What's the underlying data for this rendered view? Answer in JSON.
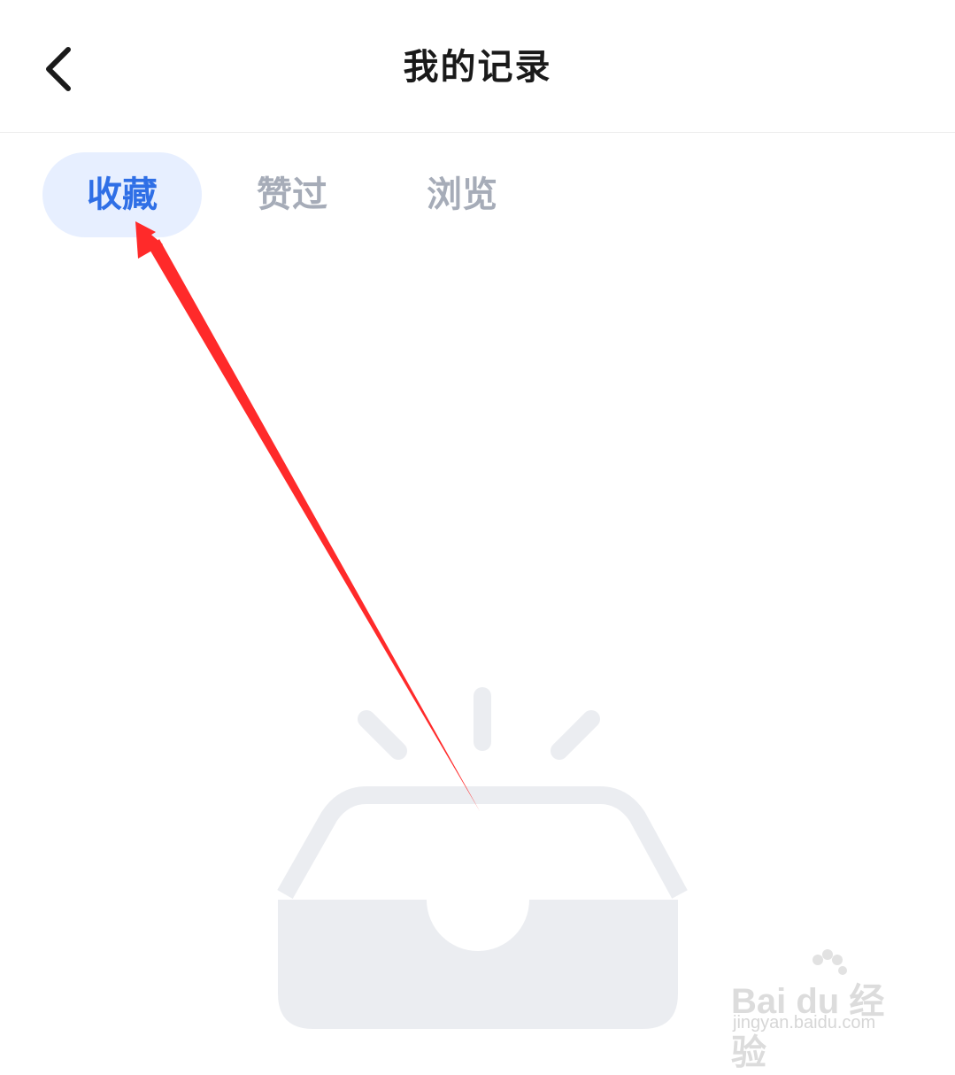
{
  "header": {
    "title": "我的记录",
    "back_icon": "chevron-left-icon"
  },
  "tabs": [
    {
      "label": "收藏",
      "active": true
    },
    {
      "label": "赞过",
      "active": false
    },
    {
      "label": "浏览",
      "active": false
    }
  ],
  "empty_state": {
    "icon": "empty-inbox-icon"
  },
  "annotation": {
    "icon": "red-arrow-icon",
    "color": "#ff2a2a"
  },
  "watermark": {
    "brand": "Bai du 经验",
    "url": "jingyan.baidu.com"
  },
  "colors": {
    "accent": "#2f6fe6",
    "tab_active_bg": "#e7efff",
    "tab_inactive": "#a6acb8",
    "illustration": "#ebedf1"
  }
}
